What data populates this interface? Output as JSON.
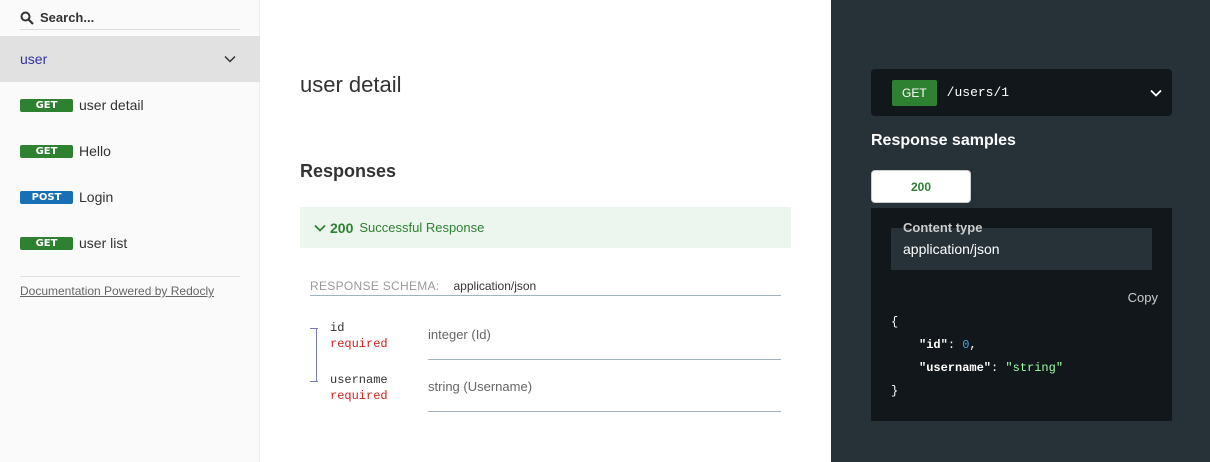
{
  "search": {
    "placeholder": "Search..."
  },
  "sidebar": {
    "group_label": "user",
    "items": [
      {
        "method": "GET",
        "label": "user detail"
      },
      {
        "method": "GET",
        "label": "Hello"
      },
      {
        "method": "POST",
        "label": "Login"
      },
      {
        "method": "GET",
        "label": "user list"
      }
    ],
    "powered": "Documentation Powered by Redocly"
  },
  "operation": {
    "title": "user detail",
    "responses_title": "Responses",
    "response": {
      "code": "200",
      "description": "Successful Response"
    },
    "schema_label": "RESPONSE SCHEMA:",
    "schema_type": "application/json",
    "props": [
      {
        "name": "id",
        "required": "required",
        "type": "integer (Id)"
      },
      {
        "name": "username",
        "required": "required",
        "type": "string (Username)"
      }
    ]
  },
  "panel": {
    "method": "GET",
    "path": "/users/1",
    "samples_title": "Response samples",
    "tab": "200",
    "content_type_label": "Content type",
    "content_type": "application/json",
    "copy": "Copy",
    "code": {
      "open": "{",
      "id_key": "\"id\"",
      "id_val": "0",
      "username_key": "\"username\"",
      "username_val": "\"string\"",
      "close": "}"
    }
  },
  "colors": {
    "get": "#2f8132",
    "post": "#186fb5",
    "required": "#d41f1c",
    "dark": "#263238"
  }
}
